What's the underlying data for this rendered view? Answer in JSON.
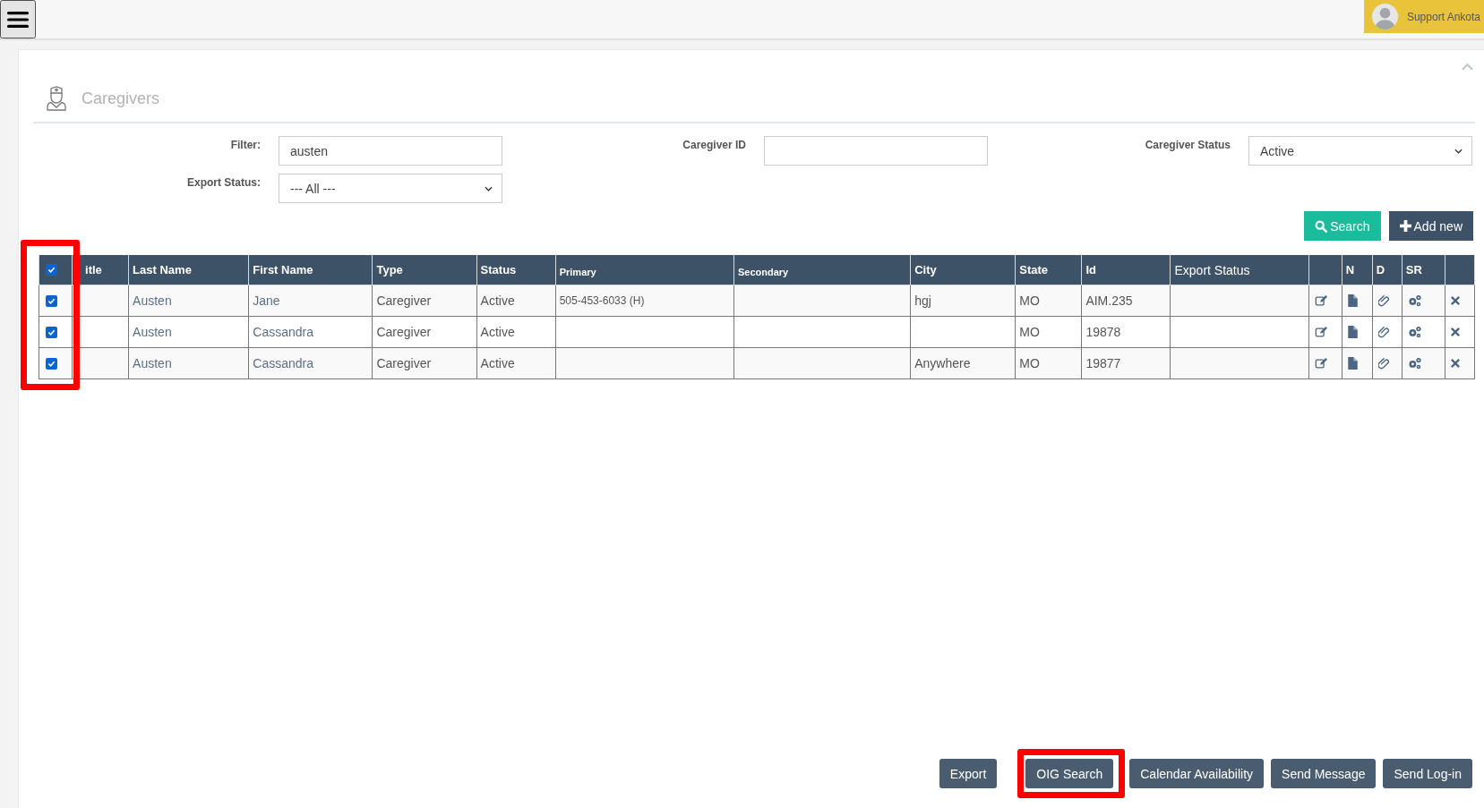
{
  "topbar": {
    "user": "Support Ankota"
  },
  "panel": {
    "title": "Caregivers"
  },
  "filters": [
    {
      "label": "Filter:",
      "kind": "text",
      "value": "austen"
    },
    {
      "label": "Caregiver ID",
      "kind": "text"
    },
    {
      "label": "Caregiver Status",
      "kind": "select",
      "value": "Active"
    },
    {
      "label": "Export Status:",
      "kind": "select",
      "value": "--- All ---"
    }
  ],
  "toolbar": [
    {
      "label": "Search",
      "kind": "search"
    },
    {
      "label": "Add new",
      "kind": "add"
    }
  ],
  "table": {
    "all_checked": true,
    "checkbox_column_highlighted": true,
    "columns": [
      {
        "label": "itle",
        "kind": "text"
      },
      {
        "label": "Last Name",
        "kind": "name"
      },
      {
        "label": "First Name",
        "kind": "name"
      },
      {
        "label": "Type",
        "kind": "text"
      },
      {
        "label": "Status",
        "kind": "text"
      },
      {
        "label": "Primary",
        "kind": "phone"
      },
      {
        "label": "Secondary",
        "kind": "phone"
      },
      {
        "label": "City",
        "kind": "text"
      },
      {
        "label": "State",
        "kind": "text"
      },
      {
        "label": "Id",
        "kind": "text"
      },
      {
        "label": "Export Status",
        "kind": "plain"
      },
      {
        "kind": "edit"
      },
      {
        "label": "N",
        "kind": "note"
      },
      {
        "label": "D",
        "kind": "attach"
      },
      {
        "label": "SR",
        "kind": "gears"
      },
      {
        "kind": "delete"
      }
    ],
    "rows": [
      {
        "checked": true,
        "cells": [
          null,
          "Austen",
          "Jane",
          "Caregiver",
          "Active",
          "505-453-6033 (H)",
          null,
          "hgj",
          "MO",
          "AIM.235",
          null
        ]
      },
      {
        "checked": true,
        "cells": [
          null,
          "Austen",
          "Cassandra",
          "Caregiver",
          "Active",
          null,
          null,
          null,
          "MO",
          "19878",
          null
        ]
      },
      {
        "checked": true,
        "cells": [
          null,
          "Austen",
          "Cassandra",
          "Caregiver",
          "Active",
          null,
          null,
          "Anywhere",
          "MO",
          "19877",
          null
        ]
      }
    ]
  },
  "actions": [
    {
      "label": "Export",
      "highlighted": false
    },
    {
      "label": "OIG Search",
      "highlighted": true
    },
    {
      "label": "Calendar Availability",
      "highlighted": false
    },
    {
      "label": "Send Message",
      "highlighted": false
    },
    {
      "label": "Send Log-in",
      "highlighted": false
    }
  ]
}
